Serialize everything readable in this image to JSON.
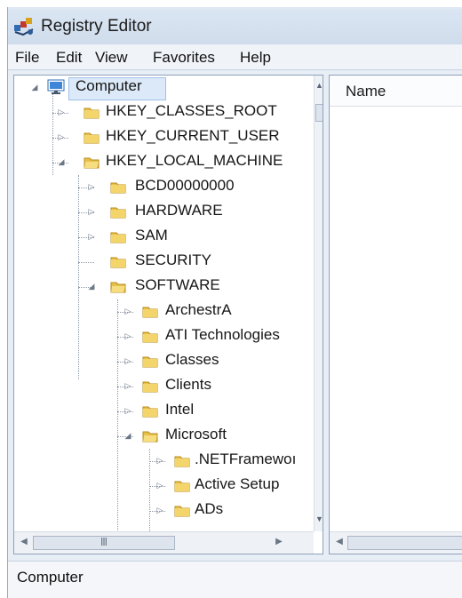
{
  "window": {
    "title": "Registry Editor",
    "icon": "registry-editor-icon"
  },
  "menubar": {
    "items": [
      "File",
      "Edit",
      "View",
      "Favorites",
      "Help"
    ]
  },
  "tree": {
    "root": "Computer",
    "items": [
      {
        "label": "HKEY_CLASSES_ROOT"
      },
      {
        "label": "HKEY_CURRENT_USER"
      },
      {
        "label": "HKEY_LOCAL_MACHINE"
      },
      {
        "label": "BCD00000000"
      },
      {
        "label": "HARDWARE"
      },
      {
        "label": "SAM"
      },
      {
        "label": "SECURITY"
      },
      {
        "label": "SOFTWARE"
      },
      {
        "label": "ArchestrA"
      },
      {
        "label": "ATI Technologies"
      },
      {
        "label": "Classes"
      },
      {
        "label": "Clients"
      },
      {
        "label": "Intel"
      },
      {
        "label": "Microsoft"
      },
      {
        "label": ".NETFramewoı"
      },
      {
        "label": "Active Setup"
      },
      {
        "label": "ADs"
      }
    ],
    "scroll_grip": "Ⅲ"
  },
  "details": {
    "column_name": "Name"
  },
  "statusbar": {
    "path": "Computer"
  }
}
